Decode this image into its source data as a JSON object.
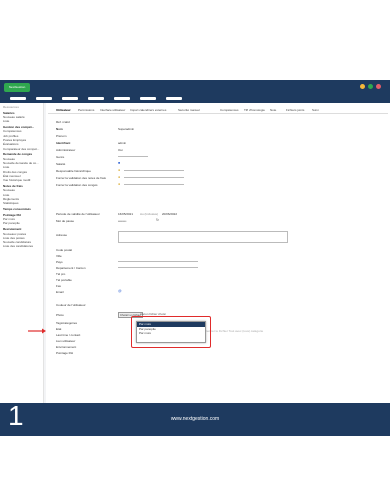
{
  "app": {
    "brand": "NextGestion",
    "footer_number": "1",
    "footer_url": "www.nextgestion.com"
  },
  "colors": {
    "navy": "#1e3a5f",
    "green": "#2fa84f",
    "red_highlight": "#e02b2b",
    "dot1": "#f5b73b",
    "dot2": "#2fa84f",
    "dot3": "#e35d6a"
  },
  "sidebar": {
    "title": "Ressources",
    "sections": [
      {
        "heading": "Salariés",
        "items": [
          "Nouveau salarié",
          "Liste"
        ]
      },
      {
        "heading": "Gestion des compét...",
        "items": [
          "Compétences",
          "Job profiles",
          "Postes Employés",
          "Évaluations",
          "Comparateur des compét..."
        ]
      },
      {
        "heading": "Demande de congés",
        "items": [
          "Nouveau",
          "Nouvelle demande de co...",
          "Liste",
          "Droits des congés",
          "État mensuel",
          "Vue historique modif."
        ]
      },
      {
        "heading": "Notes de frais",
        "items": [
          "Nouveau",
          "Liste",
          "Règlements",
          "Statistiques"
        ]
      },
      {
        "heading": "Temps consommés",
        "items": []
      },
      {
        "heading": "Pointage RH",
        "items": [
          "Par mois",
          "Par panoplie"
        ]
      },
      {
        "heading": "Recrutement",
        "items": [
          "Nouveaux postes",
          "Liste des postes",
          "Nouvelle candidature",
          "Liste des candidatures"
        ]
      }
    ]
  },
  "tabs": [
    "Utilisateur",
    "Permissions",
    "Interface utilisateur",
    "Import calendriers externes",
    "Sécurité manuel",
    "Compétences",
    "Tiff d'homologie",
    "Note",
    "Fichiers joints",
    "Suivi"
  ],
  "form": {
    "ref_label": "Réf. rcatid",
    "nom_label": "Nom",
    "nom_value": "Superadmin",
    "prenom_label": "Prénom",
    "identifiant_label": "Identifiant",
    "identifiant_value": "admin",
    "admin_label": "Administrateur",
    "admin_value": "Oui",
    "genre_label": "Genre",
    "salarie_label": "Salarié",
    "resp_label": "Responsable hiérarchique",
    "fwnotes_label": "Forcer la validation des notes de frais",
    "fwconges_label": "Forcer la validation des congés",
    "extern_label": "Utilisateur externe ?",
    "extern_value": "Interne",
    "period_label": "Période de validité de l'utilisateur",
    "date_start": "16/05/2021",
    "date_sep": "Au (Inclusive)",
    "date_end": "20/06/2022",
    "mdp_label": "Mot de passe",
    "mdp_value": "••••••••",
    "adresse_label": "Adresse",
    "cp_label": "Code postal",
    "ville_label": "Ville",
    "pays_label": "Pays",
    "dept_label": "Département / Canton",
    "tel_label": "Tél pro",
    "telport_label": "Tél portable",
    "fax_label": "Fax",
    "email_label": "Email",
    "couleur_label": "Couleur de l'utilisateur",
    "photo_label": "Photo",
    "photo_button": "Choisir un fichier",
    "photo_status": "Aucun fichier choisi",
    "tags_label": "Tags/catégories",
    "etat_label": "Etat",
    "lastcontact_label": "Last time / contact",
    "lien_label": "Lien utilisateur",
    "env_label": "Environnement",
    "pointage_label": "Pointage RH",
    "pointage_value": "Par mois",
    "hint_text": "rentrer le Fichier Tout avec (tous) catégorie"
  },
  "dropdown": {
    "options": [
      "Par mois",
      "Par panoplie",
      "Par mois"
    ],
    "selected_index": 0
  }
}
